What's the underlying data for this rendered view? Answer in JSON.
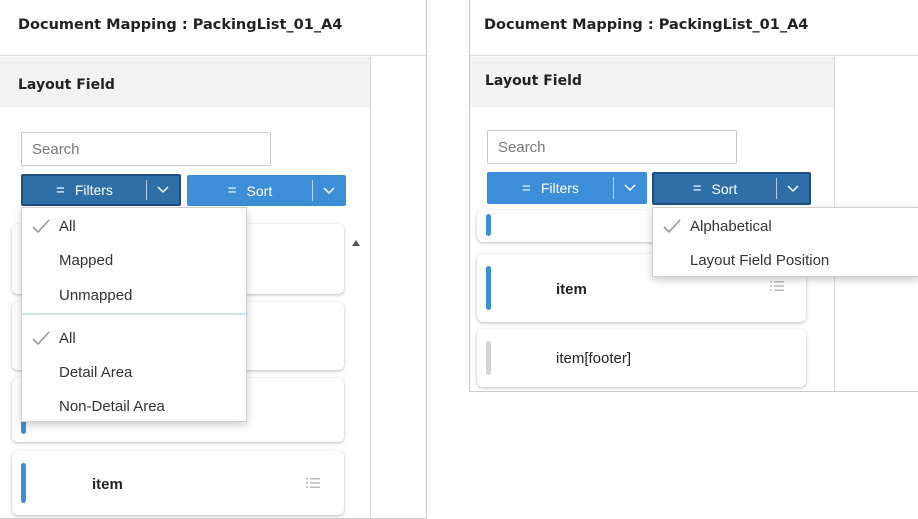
{
  "left_panel": {
    "title": "Document Mapping : PackingList_01_A4",
    "section_title": "Layout Field",
    "search_placeholder": "Search",
    "filters_button": {
      "label": "Filters",
      "state": "open"
    },
    "sort_button": {
      "label": "Sort"
    },
    "filters_menu": {
      "group1": [
        {
          "label": "All",
          "checked": true
        },
        {
          "label": "Mapped",
          "checked": false
        },
        {
          "label": "Unmapped",
          "checked": false
        }
      ],
      "group2": [
        {
          "label": "All",
          "checked": true
        },
        {
          "label": "Detail Area",
          "checked": false
        },
        {
          "label": "Non-Detail Area",
          "checked": false
        }
      ]
    },
    "fields": [
      {
        "label": "item",
        "mapped": true
      }
    ]
  },
  "right_panel": {
    "title": "Document Mapping : PackingList_01_A4",
    "section_title": "Layout Field",
    "search_placeholder": "Search",
    "filters_button": {
      "label": "Filters"
    },
    "sort_button": {
      "label": "Sort",
      "state": "open"
    },
    "sort_menu": [
      {
        "label": "Alphabetical",
        "checked": true
      },
      {
        "label": "Layout Field Position",
        "checked": false
      }
    ],
    "fields": [
      {
        "label": "item",
        "mapped": true
      },
      {
        "label": "item[footer]",
        "mapped": false
      }
    ]
  },
  "colors": {
    "accent": "#3d8ed8",
    "accent_active": "#2f6fa8",
    "unmapped_bar": "#d3d3d3",
    "header_bg": "#f2f2f2"
  },
  "icons": {
    "filter_lines": "equals-lines-icon",
    "caret": "chevron-down-icon",
    "check": "checkmark-icon",
    "list": "list-icon",
    "scroll": "scroll-up-arrow-icon"
  }
}
